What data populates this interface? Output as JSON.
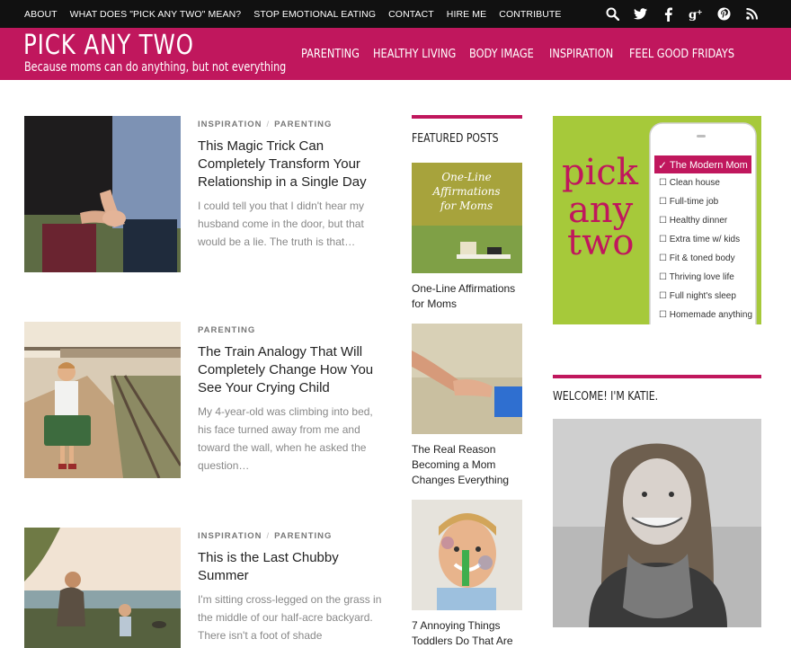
{
  "topbar": {
    "links": [
      "ABOUT",
      "WHAT DOES \"PICK ANY TWO\" MEAN?",
      "STOP EMOTIONAL EATING",
      "CONTACT",
      "HIRE ME",
      "CONTRIBUTE"
    ],
    "social_icons": [
      "search-icon",
      "twitter-icon",
      "facebook-icon",
      "google-plus-icon",
      "pinterest-icon",
      "rss-icon"
    ]
  },
  "header": {
    "title": "PICK ANY TWO",
    "tagline": "Because moms can do anything, but not everything",
    "nav": [
      "PARENTING",
      "HEALTHY LIVING",
      "BODY IMAGE",
      "INSPIRATION",
      "FEEL GOOD FRIDAYS"
    ]
  },
  "posts": [
    {
      "categories": [
        "INSPIRATION",
        "PARENTING"
      ],
      "title": "This Magic Trick Can Completely Transform Your Relationship in a Single Day",
      "excerpt": "I could tell you that I didn't hear my husband come in the door, but that would be a lie. The truth is that…"
    },
    {
      "categories": [
        "PARENTING"
      ],
      "title": "The Train Analogy That Will Completely Change How You See Your Crying Child",
      "excerpt": "My 4-year-old was climbing into bed, his face turned away from me and toward the wall, when he asked the question…"
    },
    {
      "categories": [
        "INSPIRATION",
        "PARENTING"
      ],
      "title": "This is the Last Chubby Summer",
      "excerpt": "I'm sitting cross-legged on the grass in the middle of our half-acre backyard. There isn't a foot of shade"
    }
  ],
  "featured": {
    "heading": "FEATURED POSTS",
    "items": [
      {
        "caption": "One-Line Affirmations for Moms",
        "image_text": "One-Line Affirmations for Moms"
      },
      {
        "caption": "The Real Reason Becoming a Mom Changes Everything"
      },
      {
        "caption": "7 Annoying Things Toddlers Do That Are"
      }
    ]
  },
  "sidebar": {
    "ad": {
      "big_text": [
        "pick",
        "any",
        "two"
      ],
      "checklist_title": "The Modern Mom",
      "checklist": [
        "Clean house",
        "Full-time job",
        "Healthy dinner",
        "Extra time w/ kids",
        "Fit & toned body",
        "Thriving love life",
        "Full night's sleep",
        "Homemade anything"
      ]
    },
    "welcome_heading": "WELCOME! I'M KATIE."
  },
  "colors": {
    "brand": "#c0175d",
    "topbar": "#111111",
    "ad_green": "#a6c93a"
  }
}
